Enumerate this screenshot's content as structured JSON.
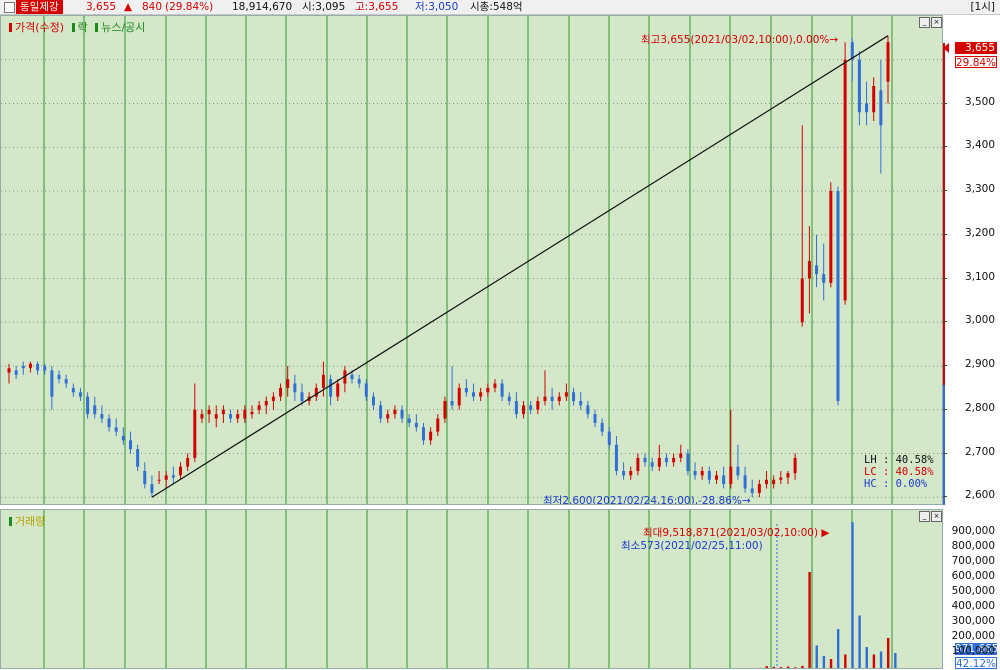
{
  "header": {
    "stock_name": "동일제강",
    "price": "3,655",
    "change_arrow": "▲",
    "change": "840",
    "change_pct": "(29.84%)",
    "volume": "18,914,670",
    "open": "시:3,095",
    "high": "고:3,655",
    "low": "저:3,050",
    "market_cap": "시총:548억",
    "period": "[1시]"
  },
  "price_pane": {
    "legend": [
      "가격(수정)",
      "락",
      "뉴스/공시"
    ],
    "legend_colors": [
      "#d40000",
      "#1a8a1a",
      "#1a8a1a"
    ],
    "high_annotation": "최고3,655(2021/03/02,10:00),0.00%→",
    "low_annotation": "최저2,600(2021/02/24,16:00),-28.86%→",
    "lh": "LH : 40.58%",
    "lc": "LC : 40.58%",
    "hc": "HC :  0.00%",
    "y_labels": [
      "3,500",
      "3,400",
      "3,300",
      "3,200",
      "3,100",
      "3,000",
      "2,900",
      "2,800",
      "2,700",
      "2,600"
    ],
    "current_tag": "3,655",
    "current_pct": "29.84%"
  },
  "volume_pane": {
    "legend": "거래량",
    "max_annotation": "최대9,518,871(2021/03/02,10:00) ▶",
    "min_annotation": "최소573(2021/02/25,11:00)",
    "y_labels": [
      "900,000",
      "800,000",
      "700,000",
      "600,000",
      "500,000",
      "400,000",
      "300,000",
      "200,000",
      "100,000"
    ],
    "current_tag": "971,665",
    "current_pct": "42.12%"
  },
  "colors": {
    "up": "#d40000",
    "down": "#2f6fd6",
    "background": "#d4e7c9",
    "grid": "#2a9a2a"
  },
  "chart_data": {
    "type": "candlestick",
    "y_range": [
      2580,
      3700
    ],
    "vol_range": [
      0,
      1000000
    ],
    "candles": [
      [
        2885,
        2905,
        2860,
        2895
      ],
      [
        2890,
        2900,
        2870,
        2880
      ],
      [
        2900,
        2910,
        2880,
        2895
      ],
      [
        2895,
        2910,
        2885,
        2905
      ],
      [
        2905,
        2910,
        2880,
        2890
      ],
      [
        2900,
        2905,
        2880,
        2890
      ],
      [
        2890,
        2900,
        2800,
        2830
      ],
      [
        2880,
        2890,
        2860,
        2870
      ],
      [
        2870,
        2880,
        2850,
        2860
      ],
      [
        2850,
        2860,
        2830,
        2840
      ],
      [
        2840,
        2850,
        2820,
        2830
      ],
      [
        2830,
        2840,
        2780,
        2790
      ],
      [
        2810,
        2830,
        2780,
        2790
      ],
      [
        2790,
        2810,
        2770,
        2780
      ],
      [
        2780,
        2790,
        2750,
        2760
      ],
      [
        2760,
        2780,
        2740,
        2750
      ],
      [
        2740,
        2760,
        2720,
        2730
      ],
      [
        2730,
        2750,
        2700,
        2710
      ],
      [
        2710,
        2720,
        2660,
        2670
      ],
      [
        2660,
        2680,
        2620,
        2630
      ],
      [
        2630,
        2650,
        2600,
        2610
      ],
      [
        2640,
        2660,
        2630,
        2640
      ],
      [
        2640,
        2660,
        2620,
        2650
      ],
      [
        2650,
        2670,
        2630,
        2645
      ],
      [
        2650,
        2680,
        2640,
        2670
      ],
      [
        2670,
        2700,
        2660,
        2690
      ],
      [
        2690,
        2860,
        2680,
        2800
      ],
      [
        2780,
        2800,
        2770,
        2790
      ],
      [
        2790,
        2810,
        2770,
        2800
      ],
      [
        2780,
        2810,
        2760,
        2790
      ],
      [
        2790,
        2810,
        2770,
        2800
      ],
      [
        2790,
        2800,
        2770,
        2780
      ],
      [
        2780,
        2800,
        2770,
        2790
      ],
      [
        2780,
        2810,
        2770,
        2800
      ],
      [
        2790,
        2810,
        2780,
        2795
      ],
      [
        2800,
        2820,
        2790,
        2810
      ],
      [
        2810,
        2830,
        2790,
        2820
      ],
      [
        2820,
        2840,
        2800,
        2830
      ],
      [
        2830,
        2860,
        2820,
        2850
      ],
      [
        2850,
        2900,
        2830,
        2870
      ],
      [
        2860,
        2880,
        2820,
        2840
      ],
      [
        2840,
        2860,
        2810,
        2820
      ],
      [
        2820,
        2840,
        2810,
        2830
      ],
      [
        2830,
        2860,
        2820,
        2850
      ],
      [
        2850,
        2910,
        2830,
        2880
      ],
      [
        2870,
        2880,
        2810,
        2830
      ],
      [
        2830,
        2870,
        2820,
        2860
      ],
      [
        2860,
        2900,
        2840,
        2890
      ],
      [
        2880,
        2890,
        2860,
        2870
      ],
      [
        2870,
        2880,
        2850,
        2860
      ],
      [
        2860,
        2870,
        2820,
        2830
      ],
      [
        2830,
        2840,
        2800,
        2810
      ],
      [
        2810,
        2820,
        2770,
        2780
      ],
      [
        2780,
        2800,
        2770,
        2790
      ],
      [
        2790,
        2810,
        2780,
        2800
      ],
      [
        2800,
        2810,
        2770,
        2780
      ],
      [
        2780,
        2790,
        2760,
        2770
      ],
      [
        2770,
        2790,
        2750,
        2760
      ],
      [
        2760,
        2770,
        2720,
        2730
      ],
      [
        2730,
        2760,
        2720,
        2750
      ],
      [
        2750,
        2790,
        2740,
        2780
      ],
      [
        2780,
        2830,
        2770,
        2820
      ],
      [
        2820,
        2900,
        2800,
        2810
      ],
      [
        2810,
        2860,
        2800,
        2850
      ],
      [
        2850,
        2870,
        2830,
        2840
      ],
      [
        2840,
        2860,
        2820,
        2830
      ],
      [
        2830,
        2850,
        2820,
        2840
      ],
      [
        2840,
        2860,
        2830,
        2850
      ],
      [
        2850,
        2870,
        2840,
        2860
      ],
      [
        2860,
        2870,
        2820,
        2830
      ],
      [
        2830,
        2840,
        2810,
        2820
      ],
      [
        2820,
        2840,
        2780,
        2790
      ],
      [
        2790,
        2820,
        2780,
        2810
      ],
      [
        2810,
        2820,
        2790,
        2800
      ],
      [
        2800,
        2830,
        2790,
        2820
      ],
      [
        2820,
        2890,
        2810,
        2830
      ],
      [
        2830,
        2850,
        2800,
        2820
      ],
      [
        2820,
        2840,
        2810,
        2830
      ],
      [
        2830,
        2860,
        2820,
        2840
      ],
      [
        2840,
        2850,
        2810,
        2820
      ],
      [
        2820,
        2840,
        2800,
        2810
      ],
      [
        2810,
        2820,
        2780,
        2790
      ],
      [
        2790,
        2800,
        2760,
        2770
      ],
      [
        2770,
        2780,
        2740,
        2750
      ],
      [
        2750,
        2760,
        2710,
        2720
      ],
      [
        2720,
        2740,
        2650,
        2660
      ],
      [
        2660,
        2680,
        2640,
        2650
      ],
      [
        2650,
        2670,
        2640,
        2660
      ],
      [
        2660,
        2700,
        2650,
        2690
      ],
      [
        2690,
        2700,
        2670,
        2680
      ],
      [
        2680,
        2690,
        2660,
        2670
      ],
      [
        2670,
        2720,
        2660,
        2690
      ],
      [
        2690,
        2700,
        2670,
        2680
      ],
      [
        2680,
        2700,
        2670,
        2690
      ],
      [
        2690,
        2720,
        2680,
        2700
      ],
      [
        2700,
        2710,
        2650,
        2660
      ],
      [
        2660,
        2680,
        2640,
        2650
      ],
      [
        2650,
        2670,
        2640,
        2660
      ],
      [
        2660,
        2670,
        2630,
        2640
      ],
      [
        2640,
        2660,
        2630,
        2650
      ],
      [
        2650,
        2670,
        2620,
        2630
      ],
      [
        2630,
        2800,
        2620,
        2670
      ],
      [
        2670,
        2720,
        2640,
        2650
      ],
      [
        2650,
        2670,
        2610,
        2620
      ],
      [
        2620,
        2640,
        2600,
        2610
      ],
      [
        2610,
        2640,
        2600,
        2630
      ],
      [
        2630,
        2660,
        2620,
        2640
      ],
      [
        2630,
        2650,
        2620,
        2640
      ],
      [
        2640,
        2660,
        2630,
        2645
      ],
      [
        2645,
        2660,
        2630,
        2655
      ],
      [
        2655,
        2700,
        2640,
        2690
      ],
      [
        3000,
        3450,
        2990,
        3100
      ],
      [
        3100,
        3220,
        3020,
        3140
      ],
      [
        3130,
        3200,
        3080,
        3110
      ],
      [
        3110,
        3180,
        3050,
        3090
      ],
      [
        3090,
        3320,
        3080,
        3300
      ],
      [
        3300,
        3310,
        2810,
        2820
      ],
      [
        3050,
        3640,
        3040,
        3600
      ],
      [
        3640,
        3650,
        3550,
        3600
      ],
      [
        3600,
        3620,
        3450,
        3480
      ],
      [
        3500,
        3550,
        3450,
        3480
      ],
      [
        3480,
        3560,
        3460,
        3540
      ],
      [
        3530,
        3600,
        3340,
        3450
      ],
      [
        3550,
        3655,
        3500,
        3640
      ]
    ],
    "volume": [
      0,
      0,
      0,
      0,
      0,
      0,
      0,
      0,
      0,
      0,
      0,
      0,
      0,
      0,
      0,
      0,
      0,
      0,
      0,
      0,
      0,
      0,
      0,
      0,
      0,
      0,
      0,
      0,
      0,
      0,
      0,
      0,
      0,
      0,
      0,
      0,
      0,
      0,
      0,
      0,
      0,
      0,
      0,
      0,
      0,
      0,
      0,
      0,
      0,
      0,
      0,
      0,
      0,
      0,
      0,
      0,
      0,
      0,
      0,
      0,
      0,
      0,
      0,
      0,
      0,
      0,
      0,
      0,
      0,
      0,
      0,
      0,
      0,
      0,
      0,
      0,
      0,
      0,
      0,
      0,
      0,
      0,
      0,
      0,
      0,
      0,
      0,
      0,
      0,
      0,
      0,
      0,
      0,
      0,
      0,
      0,
      0,
      0,
      0,
      0,
      0,
      0,
      0,
      0,
      0,
      573,
      12000,
      8000,
      6000,
      10000,
      5000,
      14000,
      640000,
      150000,
      80000,
      60000,
      260000,
      90000,
      971665,
      350000,
      140000,
      90000,
      110000,
      200000,
      100000
    ]
  }
}
